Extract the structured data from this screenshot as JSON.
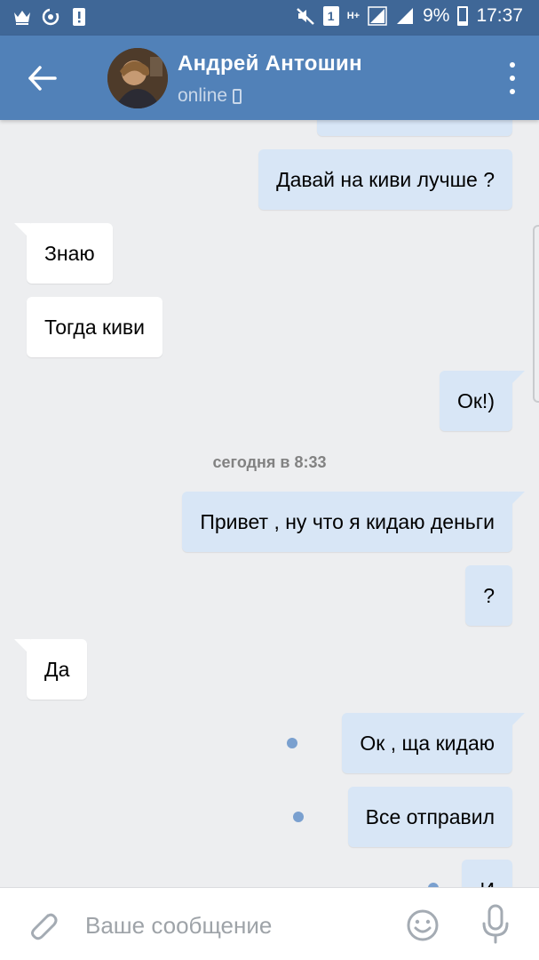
{
  "status_bar": {
    "left_icons": [
      "crown-icon",
      "sync-icon",
      "alert-icon"
    ],
    "sim_number": "1",
    "network": "H+",
    "battery": "9%",
    "time": "17:37"
  },
  "header": {
    "title": "Андрей Антошин",
    "status": "online"
  },
  "chat": {
    "date_separator": "сегодня в 8:33",
    "messages": [
      {
        "text": "",
        "direction": "out",
        "unread": false
      },
      {
        "text": "Давай на киви лучше ?",
        "direction": "out",
        "unread": false
      },
      {
        "text": "Знаю",
        "direction": "in",
        "unread": false
      },
      {
        "text": "Тогда киви",
        "direction": "in",
        "unread": false
      },
      {
        "text": "Ок!)",
        "direction": "out",
        "unread": false
      },
      {
        "text": "Привет , ну что я кидаю деньги",
        "direction": "out",
        "unread": false
      },
      {
        "text": "?",
        "direction": "out",
        "unread": false
      },
      {
        "text": "Да",
        "direction": "in",
        "unread": false
      },
      {
        "text": "Ок , ща кидаю",
        "direction": "out",
        "unread": true
      },
      {
        "text": "Все отправил",
        "direction": "out",
        "unread": true
      },
      {
        "text": "И",
        "direction": "out",
        "unread": true
      }
    ]
  },
  "input": {
    "placeholder": "Ваше сообщение",
    "value": ""
  },
  "colors": {
    "header": "#5181b8",
    "status_bar": "#3f6797",
    "outgoing_bubble": "#d8e6f6",
    "incoming_bubble": "#ffffff",
    "background": "#edeef0",
    "unread_dot": "#7aa0cf"
  }
}
